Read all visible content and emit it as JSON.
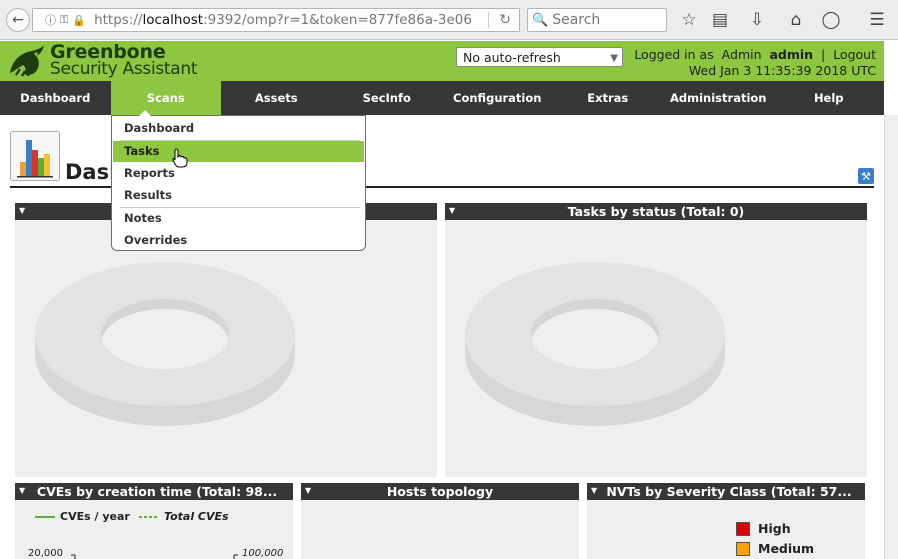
{
  "browser": {
    "url_scheme": "https://",
    "url_host": "localhost",
    "url_rest": ":9392/omp?r=1&token=877fe86a-3e06",
    "search_placeholder": "Search"
  },
  "header": {
    "logo_line1": "Greenbone",
    "logo_line2": "Security Assistant",
    "refresh_selected": "No auto-refresh",
    "logged_in_prefix": "Logged in as",
    "role": "Admin",
    "username": "admin",
    "separator": "|",
    "logout": "Logout",
    "datetime": "Wed Jan 3 11:35:39 2018 UTC"
  },
  "nav": {
    "items": [
      "Dashboard",
      "Scans",
      "Assets",
      "SecInfo",
      "Configuration",
      "Extras",
      "Administration",
      "Help"
    ],
    "active": "Scans"
  },
  "dropdown": {
    "items": [
      "Dashboard",
      "Tasks",
      "Reports",
      "Results",
      "Notes",
      "Overrides"
    ],
    "hovered": "Tasks"
  },
  "page": {
    "title": "Dashboard"
  },
  "panels": {
    "p2_title": "Tasks by status (Total: 0)",
    "p3_title": "CVEs by creation time (Total: 98...",
    "p4_title": "Hosts topology",
    "p5_title": "NVTs by Severity Class (Total: 57...",
    "cve_legend_year": "CVEs / year",
    "cve_legend_total": "Total CVEs",
    "cve_ytick_left": "20,000",
    "cve_ytick_right": "100,000",
    "severity_high": "High",
    "severity_medium": "Medium"
  },
  "colors": {
    "gsa_green": "#8dc63f",
    "nav_dark": "#393637",
    "high": "#d60000",
    "medium": "#f5a300"
  }
}
